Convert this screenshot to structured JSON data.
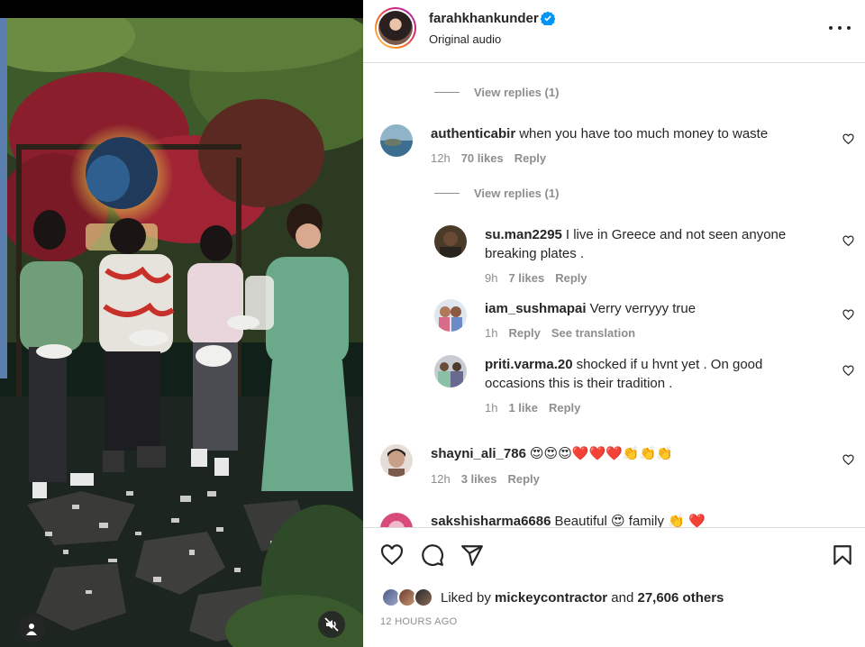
{
  "post": {
    "username": "farahkhankunder",
    "audio_label": "Original audio",
    "verified_icon": "verified-badge-icon",
    "more_icon": "more-options-icon"
  },
  "comments": {
    "view_replies_1": "View replies (1)",
    "c1": {
      "username": "authenticabir",
      "text": "when you have too much money to waste",
      "time": "12h",
      "likes": "70 likes",
      "reply": "Reply"
    },
    "view_replies_2": "View replies (1)",
    "r1": {
      "username": "su.man2295",
      "text": "I live in Greece and not seen anyone breaking plates .",
      "time": "9h",
      "likes": "7 likes",
      "reply": "Reply"
    },
    "r2": {
      "username": "iam_sushmapai",
      "text": "Verry verryyy true",
      "time": "1h",
      "reply": "Reply",
      "translate": "See translation"
    },
    "r3": {
      "username": "priti.varma.20",
      "text": "shocked if u hvnt yet . On good occasions this is their tradition .",
      "time": "1h",
      "likes": "1 like",
      "reply": "Reply"
    },
    "c2": {
      "username": "shayni_ali_786",
      "text": "😍😍😍❤️❤️❤️👏👏👏",
      "time": "12h",
      "likes": "3 likes",
      "reply": "Reply"
    },
    "c3": {
      "username": "sakshisharma6686",
      "text": "Beautiful 😍 family 👏 ❤️"
    }
  },
  "actions": {
    "like_icon": "heart-icon",
    "comment_icon": "comment-icon",
    "share_icon": "share-icon",
    "save_icon": "bookmark-icon",
    "liked_prefix": "Liked by",
    "liked_user": "mickeycontractor",
    "liked_and": "and",
    "liked_count": "27,606 others",
    "timestamp": "12 HOURS AGO"
  },
  "colors": {
    "text": "#262626",
    "muted": "#8e8e8e",
    "verified": "#0095f6",
    "border": "#dbdbdb"
  }
}
